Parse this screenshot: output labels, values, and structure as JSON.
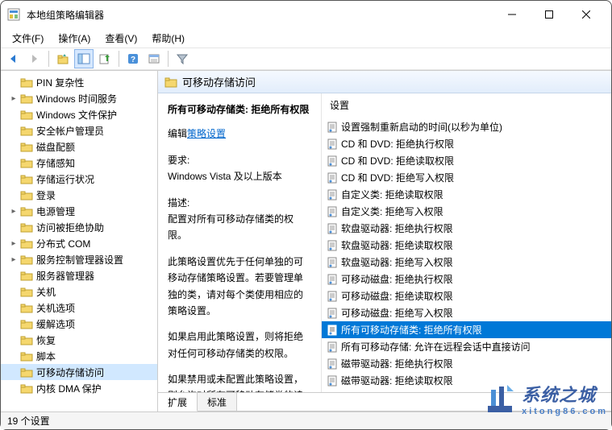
{
  "window": {
    "title": "本地组策略编辑器"
  },
  "menu": {
    "file": "文件(F)",
    "action": "操作(A)",
    "view": "查看(V)",
    "help": "帮助(H)"
  },
  "tree": {
    "items": [
      {
        "label": "PIN 复杂性",
        "exp": ""
      },
      {
        "label": "Windows 时间服务",
        "exp": "▸"
      },
      {
        "label": "Windows 文件保护",
        "exp": ""
      },
      {
        "label": "安全帐户管理员",
        "exp": ""
      },
      {
        "label": "磁盘配额",
        "exp": ""
      },
      {
        "label": "存储感知",
        "exp": ""
      },
      {
        "label": "存储运行状况",
        "exp": ""
      },
      {
        "label": "登录",
        "exp": ""
      },
      {
        "label": "电源管理",
        "exp": "▸"
      },
      {
        "label": "访问被拒绝协助",
        "exp": ""
      },
      {
        "label": "分布式 COM",
        "exp": "▸"
      },
      {
        "label": "服务控制管理器设置",
        "exp": "▸"
      },
      {
        "label": "服务器管理器",
        "exp": ""
      },
      {
        "label": "关机",
        "exp": ""
      },
      {
        "label": "关机选项",
        "exp": ""
      },
      {
        "label": "缓解选项",
        "exp": ""
      },
      {
        "label": "恢复",
        "exp": ""
      },
      {
        "label": "脚本",
        "exp": ""
      },
      {
        "label": "可移动存储访问",
        "exp": "",
        "selected": true
      },
      {
        "label": "内核 DMA 保护",
        "exp": ""
      }
    ]
  },
  "header": {
    "title": "可移动存储访问"
  },
  "detail": {
    "heading": "所有可移动存储类: 拒绝所有权限",
    "edit_prefix": "编辑",
    "edit_link": "策略设置",
    "req_label": "要求:",
    "req_value": "Windows Vista 及以上版本",
    "desc_label": "描述:",
    "desc_value": "配置对所有可移动存储类的权限。",
    "para1": "此策略设置优先于任何单独的可移动存储策略设置。若要管理单独的类，请对每个类使用相应的策略设置。",
    "para2": "如果启用此策略设置，则将拒绝对任何可移动存储类的权限。",
    "para3": "如果禁用或未配置此策略设置，则允许对所有可移动存储类的读写权限。"
  },
  "list": {
    "header": "设置",
    "items": [
      "设置强制重新启动的时间(以秒为单位)",
      "CD 和 DVD: 拒绝执行权限",
      "CD 和 DVD: 拒绝读取权限",
      "CD 和 DVD: 拒绝写入权限",
      "自定义类: 拒绝读取权限",
      "自定义类: 拒绝写入权限",
      "软盘驱动器: 拒绝执行权限",
      "软盘驱动器: 拒绝读取权限",
      "软盘驱动器: 拒绝写入权限",
      "可移动磁盘: 拒绝执行权限",
      "可移动磁盘: 拒绝读取权限",
      "可移动磁盘: 拒绝写入权限",
      "所有可移动存储类: 拒绝所有权限",
      "所有可移动存储: 允许在远程会话中直接访问",
      "磁带驱动器: 拒绝执行权限",
      "磁带驱动器: 拒绝读取权限"
    ],
    "selected_index": 12
  },
  "tabs": {
    "extended": "扩展",
    "standard": "标准"
  },
  "status": {
    "count": "19 个设置"
  },
  "watermark": {
    "big": "系统之城",
    "small": "xitong86.com"
  }
}
